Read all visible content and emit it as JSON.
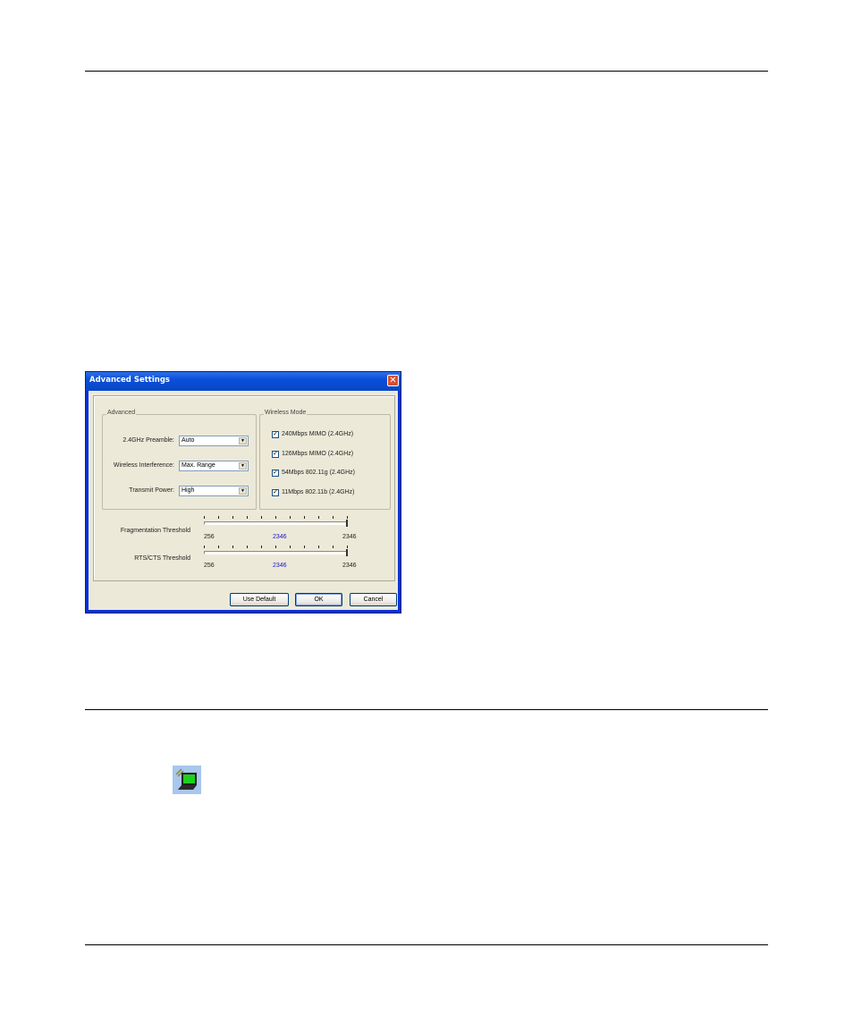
{
  "dialog": {
    "title": "Advanced Settings",
    "close_glyph": "✕",
    "advanced_group": {
      "legend": "Advanced",
      "preamble": {
        "label": "2.4GHz Preamble:",
        "value": "Auto"
      },
      "interference": {
        "label": "Wireless Interference:",
        "value": "Max. Range"
      },
      "tx_power": {
        "label": "Transmit Power:",
        "value": "High"
      }
    },
    "wireless_mode": {
      "legend": "Wireless Mode",
      "options": [
        {
          "label": "240Mbps MIMO (2.4GHz)",
          "checked": true
        },
        {
          "label": "126Mbps MIMO (2.4GHz)",
          "checked": true
        },
        {
          "label": "54Mbps 802.11g (2.4GHz)",
          "checked": true
        },
        {
          "label": "11Mbps 802.11b (2.4GHz)",
          "checked": true
        }
      ]
    },
    "fragmentation": {
      "label": "Fragmentation Threshold",
      "min": "256",
      "current": "2346",
      "max": "2346"
    },
    "rts_cts": {
      "label": "RTS/CTS Threshold",
      "min": "256",
      "current": "2346",
      "max": "2346"
    },
    "buttons": {
      "use_default": "Use Default",
      "ok": "OK",
      "cancel": "Cancel"
    },
    "check_glyph": "✓",
    "dropdown_glyph": "▼"
  },
  "icons": {
    "tray_icon": "wireless-adapter-icon"
  },
  "colors": {
    "title_bar": "#0a4fd8",
    "dialog_bg": "#ece9d8",
    "threshold_current": "#1414c8"
  }
}
